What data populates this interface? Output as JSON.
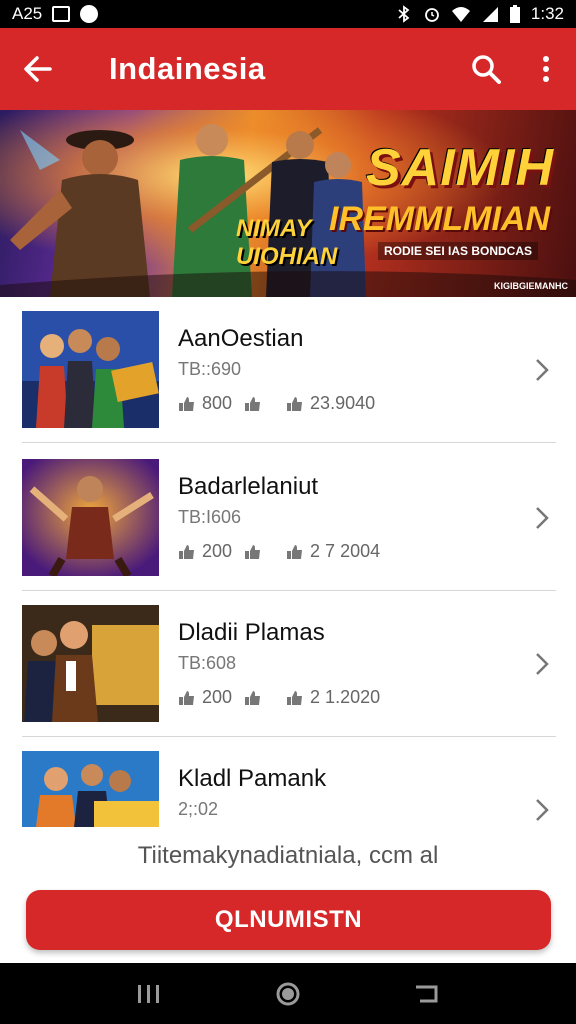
{
  "status_bar": {
    "left_label": "A25",
    "time": "1:32",
    "icons": [
      "photo-icon",
      "media-icon",
      "bluetooth-icon",
      "alarm-icon",
      "wifi-icon",
      "signal-icon",
      "battery-icon"
    ]
  },
  "app_bar": {
    "title": "Indainesia",
    "back_icon": "arrow-left-icon",
    "search_icon": "search-icon",
    "menu_icon": "more-vert-icon"
  },
  "banner": {
    "title": "SAIMIH",
    "subtitle": "IREMMLMIAN",
    "tagline": "RODIE SEI IAS BONDCAS",
    "logo_line1": "NIMAY",
    "logo_line2": "UIOHIAN",
    "credit": "KIGIBGIEMANHC"
  },
  "items": [
    {
      "title": "AanOestian",
      "meta": "TB::690",
      "stat1": "800",
      "stat2": "23.9040",
      "colors": [
        "#2a4fa8",
        "#e3a32a"
      ]
    },
    {
      "title": "Badarlelaniut",
      "meta": "TB:I606",
      "stat1": "200",
      "stat2": "2 7 2004",
      "colors": [
        "#6a2a9a",
        "#e87a2a"
      ]
    },
    {
      "title": "Dladii Plamas",
      "meta": "TB:608",
      "stat1": "200",
      "stat2": "2 1.2020",
      "colors": [
        "#3b2a1a",
        "#d8a43a"
      ]
    },
    {
      "title": "Kladl Pamank",
      "meta": "2;:02",
      "stat1": "",
      "stat2": "",
      "colors": [
        "#2b7ac8",
        "#f2c23a"
      ]
    }
  ],
  "footer_note": "Tiitemakynadiatniala, ccm al",
  "cta_label": "QLNUMISTN",
  "nav": [
    "recent-apps-icon",
    "home-icon",
    "back-icon"
  ],
  "colors": {
    "primary": "#d62828",
    "divider": "#d7d7d7"
  }
}
